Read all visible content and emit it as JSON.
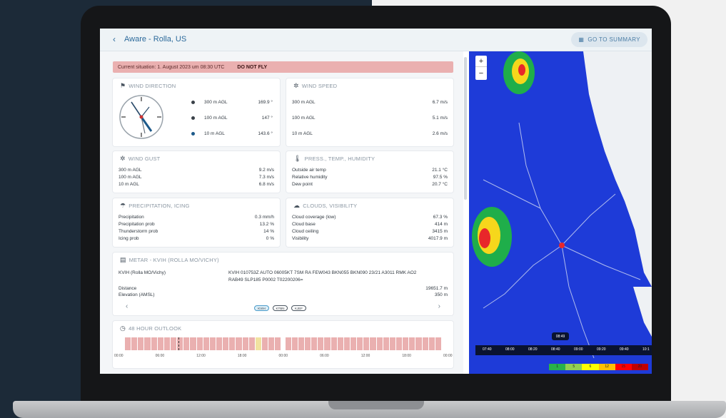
{
  "app": {
    "title": "Aware - Rolla, US",
    "summary_button": "GO TO SUMMARY"
  },
  "banner": {
    "situation": "Current situation: 1. August 2023 um 08:30 UTC",
    "status": "DO NOT FLY"
  },
  "wind_direction": {
    "title": "WIND DIRECTION",
    "rows": [
      {
        "label": "300 m AGL",
        "value": "169.9 °",
        "color": "#3a4148"
      },
      {
        "label": "100 m AGL",
        "value": "147 °",
        "color": "#3a4148"
      },
      {
        "label": "10 m AGL",
        "value": "143.6 °",
        "color": "#1d5a8a"
      }
    ]
  },
  "wind_speed": {
    "title": "WIND SPEED",
    "rows": [
      {
        "label": "300 m AGL",
        "value": "6.7 m/s"
      },
      {
        "label": "100 m AGL",
        "value": "5.1 m/s"
      },
      {
        "label": "10 m AGL",
        "value": "2.6 m/s"
      }
    ]
  },
  "wind_gust": {
    "title": "WIND GUST",
    "rows": [
      {
        "label": "300 m AGL",
        "value": "9.2 m/s"
      },
      {
        "label": "100 m AGL",
        "value": "7.3 m/s"
      },
      {
        "label": "10 m AGL",
        "value": "6.8 m/s"
      }
    ]
  },
  "press_temp": {
    "title": "PRESS., TEMP., HUMIDITY",
    "rows": [
      {
        "label": "Outside air temp",
        "value": "21.1 °C"
      },
      {
        "label": "Relative humidity",
        "value": "97.5 %"
      },
      {
        "label": "Dew point",
        "value": "20.7 °C"
      }
    ]
  },
  "precipitation": {
    "title": "PRECIPITATION, ICING",
    "rows": [
      {
        "label": "Precipitation",
        "value": "0.3 mm/h"
      },
      {
        "label": "Precipitation prob",
        "value": "13.2 %"
      },
      {
        "label": "Thunderstorm prob",
        "value": "14 %"
      },
      {
        "label": "Icing prob",
        "value": "0 %"
      }
    ]
  },
  "clouds": {
    "title": "CLOUDS, VISIBILITY",
    "rows": [
      {
        "label": "Cloud coverage (low)",
        "value": "67.3 %"
      },
      {
        "label": "Cloud base",
        "value": "414 m"
      },
      {
        "label": "Cloud ceiling",
        "value": "3415 m"
      },
      {
        "label": "Visibility",
        "value": "4017.9 m"
      }
    ]
  },
  "metar": {
    "title": "METAR - KVIH (ROLLA MO/VICHY)",
    "station": "KVIH (Rolla MO/Vichy)",
    "report_line1": "KVIH 010753Z AUTO 06005KT 7SM RA FEW043 BKN055 BKN090 23/21 A3011 RMK AO2",
    "report_line2": "RAB49 SLP185 P0002 T02200206=",
    "distance_label": "Distance",
    "distance_value": "19651.7 m",
    "elevation_label": "Elevation (AMSL)",
    "elevation_value": "350 m",
    "prev_icon": "‹",
    "next_icon": "›",
    "chips": [
      "KVIH",
      "KTBN",
      "KJEF"
    ]
  },
  "outlook": {
    "title": "48 HOUR OUTLOOK",
    "time_labels": [
      "00:00",
      "06:00",
      "12:00",
      "18:00",
      "00:00",
      "06:00",
      "12:00",
      "18:00",
      "00:00"
    ],
    "colors": {
      "no_fly": "#eab0b0",
      "caution": "#f1e2a0"
    }
  },
  "map": {
    "zoom_in": "+",
    "zoom_out": "−",
    "current_time": "08:49",
    "timeline_labels": [
      "07:40",
      "08:00",
      "08:20",
      "08:40",
      "09:00",
      "09:20",
      "09:40",
      "10:1"
    ],
    "legend_labels": [
      "1",
      "5",
      "6",
      "12",
      "15",
      "20"
    ],
    "legend_colors": [
      "#29b24a",
      "#92d050",
      "#ffff00",
      "#ffc000",
      "#ff0000",
      "#c00000"
    ],
    "base_color": "#1e3bd8"
  }
}
